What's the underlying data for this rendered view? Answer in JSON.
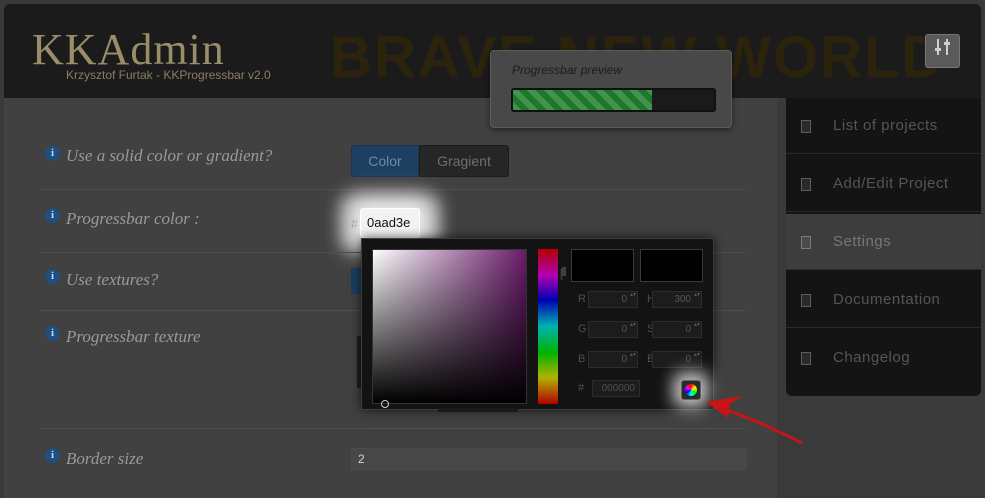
{
  "header": {
    "logo": "KKAdmin",
    "subtitle": "Krzysztof Furtak - KKProgressbar v2.0",
    "tagline": "BRAVE NEW WORLD",
    "settings_icon": "sliders-icon"
  },
  "preview": {
    "title": "Progressbar preview",
    "progress": 0.69,
    "fill_color": "#1a7a29"
  },
  "form": {
    "solid_or_gradient": {
      "label": "Use a solid color or gradient?",
      "options": [
        "Color",
        "Gragient"
      ],
      "selected": "Color"
    },
    "progressbar_color": {
      "label": "Progressbar color :",
      "prefix": "#",
      "value": "0aad3e"
    },
    "use_textures": {
      "label": "Use textures?"
    },
    "progressbar_texture": {
      "label": "Progressbar texture"
    },
    "border_size": {
      "label": "Border size",
      "value": "2"
    }
  },
  "sidebar": {
    "items": [
      {
        "label": "List of projects",
        "active": false
      },
      {
        "label": "Add/Edit Project",
        "active": false
      },
      {
        "label": "Settings",
        "active": true
      },
      {
        "label": "Documentation",
        "active": false
      },
      {
        "label": "Changelog",
        "active": false
      }
    ]
  },
  "color_picker": {
    "fields": [
      {
        "label": "R",
        "value": "0"
      },
      {
        "label": "H",
        "value": "300"
      },
      {
        "label": "G",
        "value": "0"
      },
      {
        "label": "S",
        "value": "0"
      },
      {
        "label": "B",
        "value": "0"
      },
      {
        "label": "B",
        "value": "0"
      }
    ],
    "hex_label": "#",
    "hex_value": "000000",
    "hue_marker_text": "[",
    "colors": {
      "selected_hue": "#6a1b6a",
      "swatch": "#000000"
    }
  },
  "annotation": {
    "arrow_color": "#c81414"
  }
}
